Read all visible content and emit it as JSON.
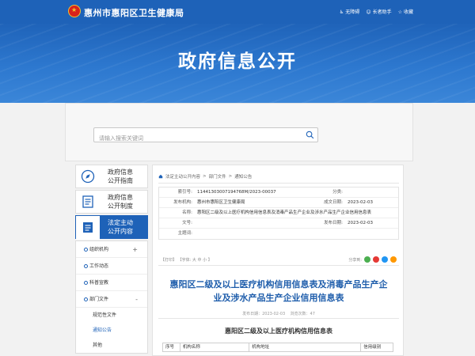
{
  "header": {
    "site_title": "惠州市惠阳区卫生健康局",
    "links": [
      {
        "icon": "accessibility-icon",
        "label": "无障碍"
      },
      {
        "icon": "elder-care-icon",
        "label": "长者助手"
      },
      {
        "icon": "bookmark-icon",
        "label": "收藏"
      }
    ]
  },
  "banner": {
    "title": "政府信息公开"
  },
  "search": {
    "placeholder": "请输入搜索关键词"
  },
  "sidebar": {
    "cards": [
      {
        "icon": "compass-icon",
        "label_line1": "政府信息",
        "label_line2": "公开指南"
      },
      {
        "icon": "document-list-icon",
        "label_line1": "政府信息",
        "label_line2": "公开制度"
      },
      {
        "icon": "folder-document-icon",
        "label_line1": "法定主动",
        "label_line2": "公开内容"
      }
    ],
    "menu": [
      {
        "label": "组织机构",
        "toggle": "+"
      },
      {
        "label": "工作动态"
      },
      {
        "label": "科普宣教"
      },
      {
        "label": "部门文件",
        "toggle": "-"
      }
    ],
    "submenu": [
      "规范性文件",
      "通知公告",
      "其他"
    ]
  },
  "breadcrumb": [
    "法定主动公开内容",
    "部门文件",
    "通知公告"
  ],
  "meta": {
    "index_label": "索引号:",
    "index_value": "114413030071947​68M/2023-00037",
    "category_label": "分类:",
    "category_value": "",
    "publisher_label": "发布机构:",
    "publisher_value": "惠州市惠阳区卫生健康局",
    "date_label": "成文日期:",
    "date_value": "2023-02-03",
    "name_label": "名称:",
    "name_value": "惠阳区二级及以上医疗机构信用信息表及消毒产品生产企业及涉水产品生产企业信用信息表",
    "docno_label": "文号:",
    "docno_value": "",
    "pubdate_label": "发布日期:",
    "pubdate_value": "2023-02-03",
    "keywords_label": "主题词:",
    "keywords_value": ""
  },
  "tools": {
    "print": "【打印】",
    "font_label": "【字体:",
    "font_sizes": [
      "大",
      "中",
      "小"
    ],
    "font_close": "】",
    "share_label": "分享到:",
    "share_colors": [
      "#4caf50",
      "#e53935",
      "#2196f3",
      "#ff9800"
    ]
  },
  "document": {
    "title_line1": "惠阳区二级及以上医疗机构信用信息表及消毒产品生产企",
    "title_line2": "业及涉水产品生产企业信用信息表",
    "meta_date": "发布日期：2023-02-03",
    "meta_views": "浏览次数：47",
    "subtitle": "惠阳区二级及以上医疗机构信用信息表",
    "table_headers": [
      "序号",
      "机构名称",
      "机构地址",
      "信用级别"
    ]
  },
  "colors": {
    "primary": "#1e62b8",
    "title": "#1e5dab"
  }
}
